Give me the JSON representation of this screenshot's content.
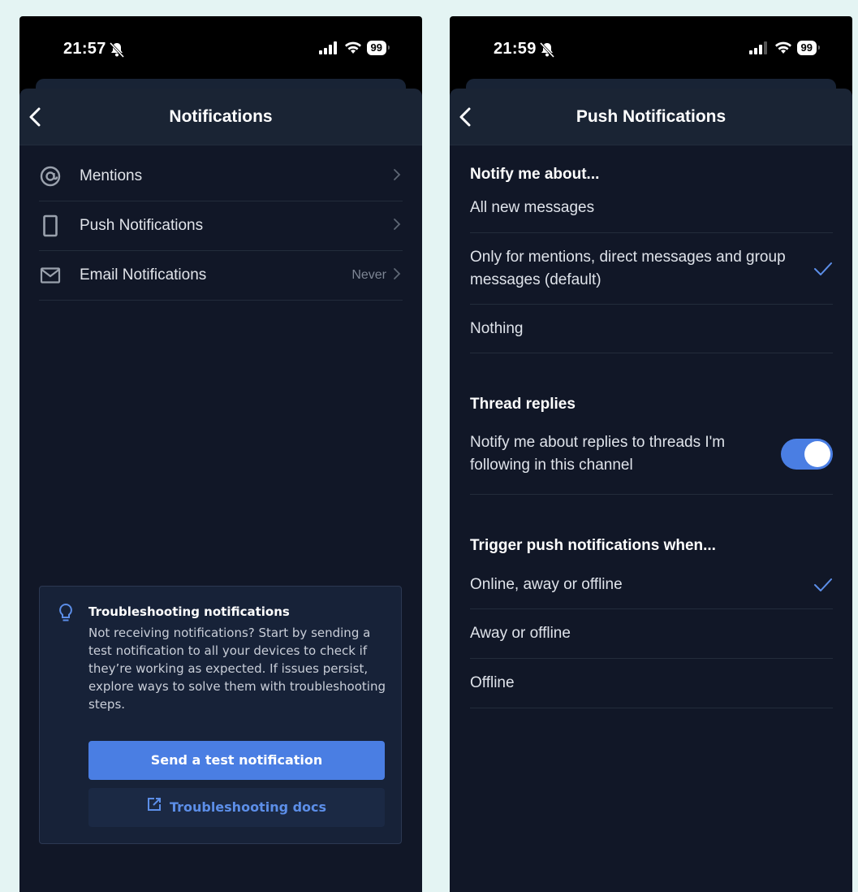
{
  "colors": {
    "background": "#e4f4f3",
    "screen": "#111727",
    "header": "#1a2434",
    "accent": "#4a7ee3",
    "link": "#5c8ee8"
  },
  "left": {
    "status": {
      "time": "21:57",
      "battery": "99"
    },
    "header": {
      "title": "Notifications",
      "back_icon": "chevron-left-icon"
    },
    "menu": [
      {
        "label": "Mentions",
        "value": "",
        "icon": "at-sign-icon"
      },
      {
        "label": "Push Notifications",
        "value": "",
        "icon": "phone-icon"
      },
      {
        "label": "Email Notifications",
        "value": "Never",
        "icon": "mail-icon"
      }
    ],
    "card": {
      "title": "Troubleshooting notifications",
      "text": "Not receiving notifications? Start by sending a test notification to all your devices to check if they’re working as expected. If issues persist, explore ways to solve them with troubleshooting steps.",
      "primary_button": "Send a test notification",
      "secondary_button": "Troubleshooting docs",
      "icon": "lightbulb-icon"
    }
  },
  "right": {
    "status": {
      "time": "21:59",
      "battery": "99"
    },
    "header": {
      "title": "Push Notifications",
      "back_icon": "chevron-left-icon"
    },
    "notify_section": {
      "title": "Notify me about...",
      "options": [
        {
          "label": "All new messages",
          "checked": false
        },
        {
          "label": "Only for mentions, direct messages and group messages (default)",
          "checked": true
        },
        {
          "label": "Nothing",
          "checked": false
        }
      ]
    },
    "thread_section": {
      "title": "Thread replies",
      "toggle_label": "Notify me about replies to threads I'm following in this channel",
      "toggle_on": true
    },
    "trigger_section": {
      "title": "Trigger push notifications when...",
      "options": [
        {
          "label": "Online, away or offline",
          "checked": true
        },
        {
          "label": "Away or offline",
          "checked": false
        },
        {
          "label": "Offline",
          "checked": false
        }
      ]
    }
  }
}
